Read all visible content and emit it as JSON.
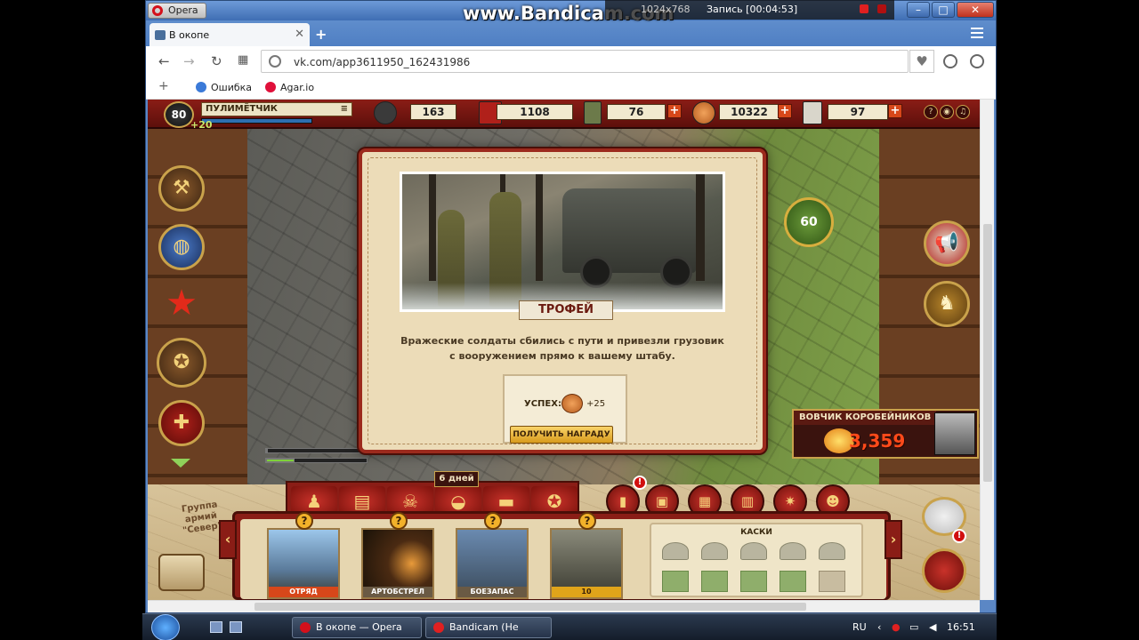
{
  "overlay": {
    "watermark": "www.Bandicam.com",
    "resolution": "1024x768",
    "recording": "Запись [00:04:53]"
  },
  "browser": {
    "menu_label": "Opera",
    "tab_title": "В окопе",
    "url": "vk.com/app3611950_162431986",
    "bookmarks": [
      {
        "label": "Ошибка",
        "color": "#3b7ad8"
      },
      {
        "label": "Agar.io",
        "color": "#e0103a"
      }
    ]
  },
  "game": {
    "level": "80",
    "rank": "ПУЛИМЁТЧИК",
    "xp_bonus": "+20",
    "resources": {
      "r1": "163",
      "r2": "1108",
      "r3": "76",
      "r4": "10322",
      "r5": "97"
    },
    "medal_value": "60",
    "player": {
      "name": "ВОВЧИК КОРОБЕЙНИКОВ",
      "score": "3,359"
    },
    "modal": {
      "title": "ТРОФЕЙ",
      "description": "Вражеские солдаты сбились с пути и привезли грузовик с вооружением прямо к вашему штабу.",
      "success_label": "УСПЕХ:",
      "reward_amount": "+25",
      "claim_button": "ПОЛУЧИТЬ НАГРАДУ"
    },
    "days_badge": "6 дней",
    "map_label": "Группа армий \"Север\"",
    "cards": [
      {
        "caption": "ОТРЯД"
      },
      {
        "caption": "АРТОБСТРЕЛ"
      },
      {
        "caption": "БОЕЗАПАС"
      },
      {
        "caption": "10"
      }
    ],
    "collection_title": "КАСКИ",
    "colors": {
      "accent_red": "#8a1d16",
      "gold": "#c9a24b",
      "score_orange": "#ff4a1a"
    }
  },
  "taskbar": {
    "items": [
      {
        "label": "В окопе — Opera",
        "color": "#d4101b"
      },
      {
        "label": "Bandicam (Не зарег...",
        "color": "#e02020"
      }
    ],
    "lang": "RU",
    "time": "16:51"
  }
}
